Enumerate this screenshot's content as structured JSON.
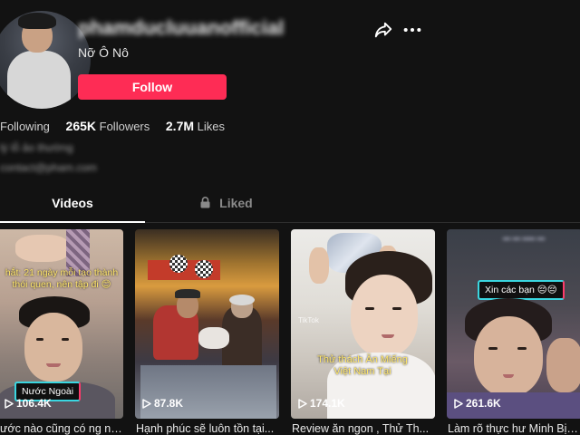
{
  "profile": {
    "username": "phamducluuanofficial",
    "nickname": "Nỡ Ô Nô",
    "follow_label": "Follow"
  },
  "stats": {
    "following_label": "Following",
    "followers_count": "265K",
    "followers_label": "Followers",
    "likes_count": "2.7M",
    "likes_label": "Likes"
  },
  "bio": {
    "line1": "lý lỗ ảo thường",
    "line2": "contact@pham.com"
  },
  "tabs": [
    {
      "label": "Videos",
      "active": true
    },
    {
      "label": "Liked",
      "active": false,
      "icon": "lock-icon"
    }
  ],
  "videos": [
    {
      "views": "106.4K",
      "title": "ước nào cũng có ng nà...",
      "overlay": "hắt: 21 ngày mỗi tạo thành\nthói quen, nên tập đi 😊",
      "sticker": "Nước Ngoài"
    },
    {
      "views": "87.8K",
      "title": "Hạnh phúc sẽ luôn tồn tại..."
    },
    {
      "views": "174.1K",
      "title": "Review ăn ngon , Thử Th...",
      "overlay": "Thử thách Ăn Miếng\nViệt Nam Tại",
      "watermark": "TikTok"
    },
    {
      "views": "261.6K",
      "title": "Làm rõ thực hư Minh Bị n...",
      "sticker": "Xin các bạn 😔😔"
    }
  ],
  "colors": {
    "background": "#121212",
    "accent": "#fe2c55",
    "text": "#ffffff",
    "muted": "#8a8a8a"
  },
  "icons": {
    "share": "share-icon",
    "more": "more-icon",
    "lock": "lock-icon",
    "play": "play-icon"
  }
}
